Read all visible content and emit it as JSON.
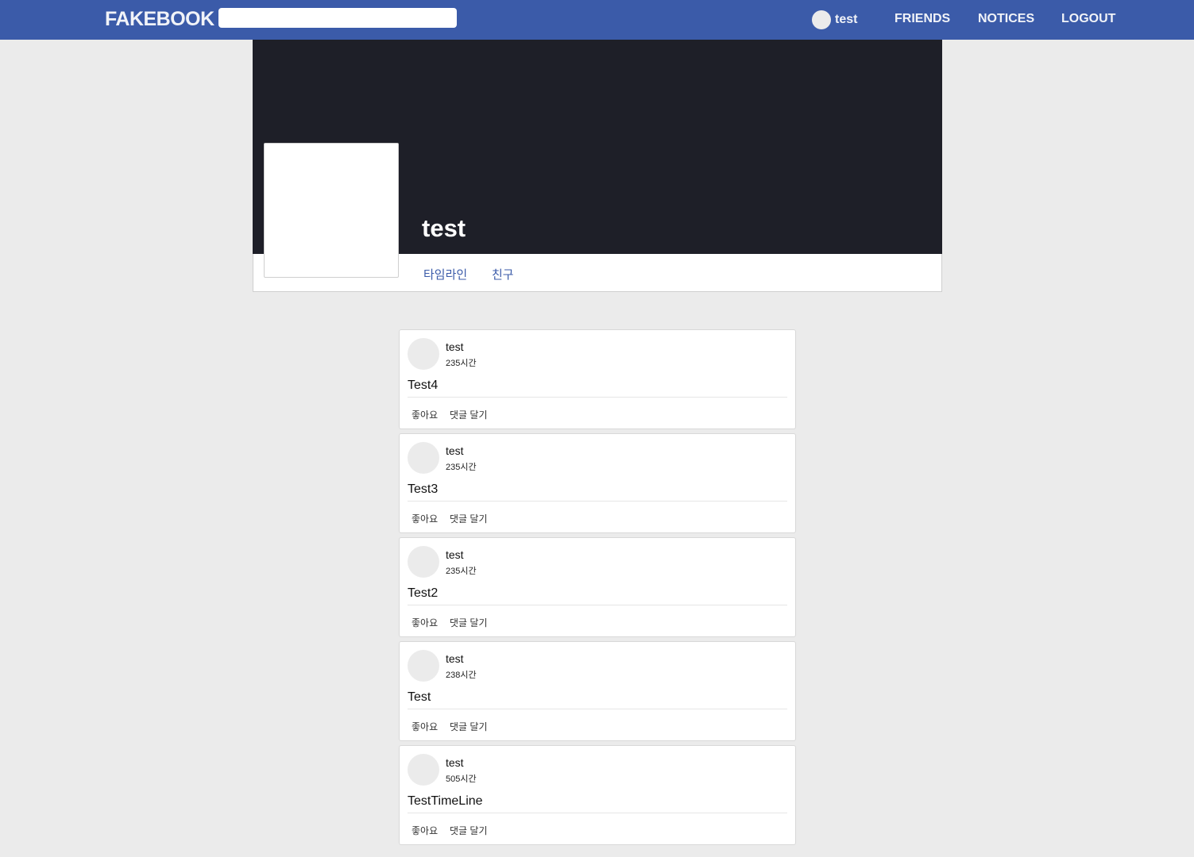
{
  "header": {
    "brand": "FAKEBOOK",
    "search_value": "",
    "search_placeholder": "",
    "user_name": "test",
    "nav": [
      "FRIENDS",
      "NOTICES",
      "LOGOUT"
    ]
  },
  "profile": {
    "name": "test",
    "tabs": [
      "타임라인",
      "친구"
    ]
  },
  "posts": [
    {
      "author": "test",
      "time": "235시간",
      "content": "Test4",
      "like": "좋아요",
      "comment": "댓글 달기"
    },
    {
      "author": "test",
      "time": "235시간",
      "content": "Test3",
      "like": "좋아요",
      "comment": "댓글 달기"
    },
    {
      "author": "test",
      "time": "235시간",
      "content": "Test2",
      "like": "좋아요",
      "comment": "댓글 달기"
    },
    {
      "author": "test",
      "time": "238시간",
      "content": "Test",
      "like": "좋아요",
      "comment": "댓글 달기"
    },
    {
      "author": "test",
      "time": "505시간",
      "content": "TestTimeLine",
      "like": "좋아요",
      "comment": "댓글 달기"
    }
  ],
  "colors": {
    "navbar": "#3b5ba9",
    "cover": "#1e1f28",
    "background": "#ebebeb",
    "tab_text": "#3b5ba9"
  }
}
